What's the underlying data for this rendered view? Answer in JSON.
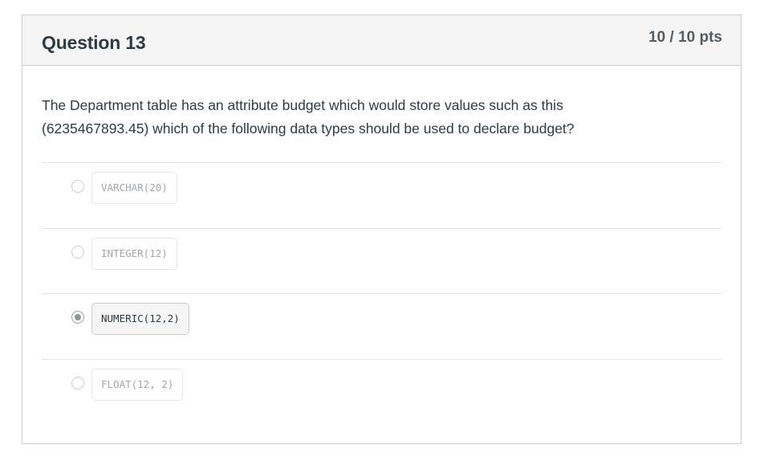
{
  "question": {
    "title": "Question 13",
    "points": "10 / 10 pts",
    "text": "The Department table has an attribute budget which would store values such as this (6235467893.45) which of the following data types should be used to declare budget?"
  },
  "answers": [
    {
      "label": "VARCHAR(20)",
      "selected": false
    },
    {
      "label": "INTEGER(12)",
      "selected": false
    },
    {
      "label": "NUMERIC(12,2)",
      "selected": true
    },
    {
      "label": "FLOAT(12, 2)",
      "selected": false
    }
  ]
}
